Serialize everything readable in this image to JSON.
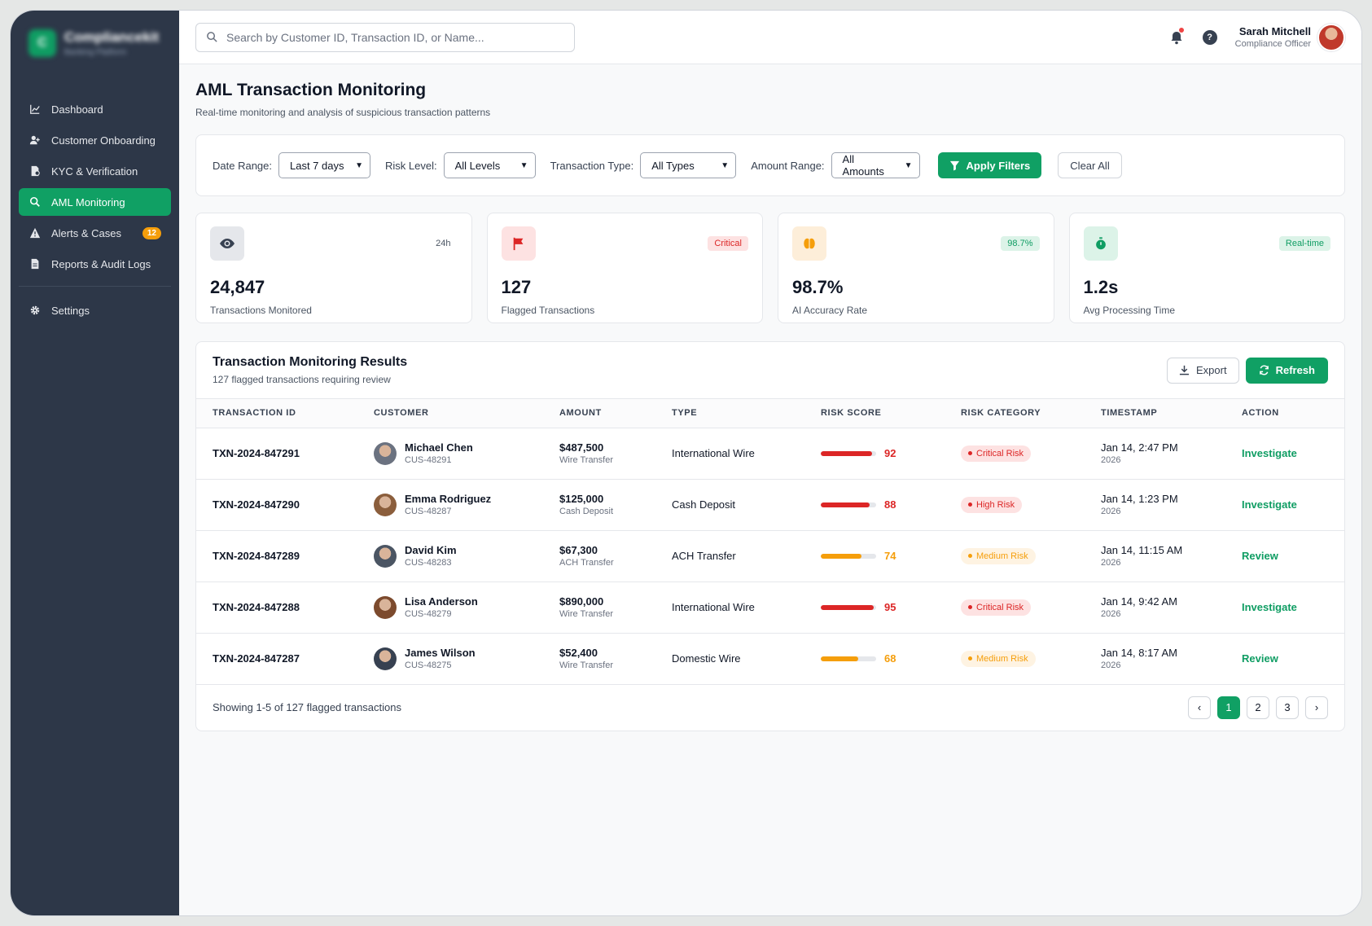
{
  "brand": {
    "name": "Compliancekit",
    "tagline": "Banking Platform",
    "mark": "C"
  },
  "sidebar": {
    "items": [
      {
        "label": "Dashboard",
        "icon": "chart-line-icon",
        "active": false
      },
      {
        "label": "Customer Onboarding",
        "icon": "user-plus-icon",
        "active": false
      },
      {
        "label": "KYC & Verification",
        "icon": "id-card-icon",
        "active": false
      },
      {
        "label": "AML Monitoring",
        "icon": "search-dollar-icon",
        "active": true
      },
      {
        "label": "Alerts & Cases",
        "icon": "warning-icon",
        "active": false,
        "badge": "12"
      },
      {
        "label": "Reports & Audit Logs",
        "icon": "file-icon",
        "active": false
      }
    ],
    "settings": {
      "label": "Settings",
      "icon": "gear-icon"
    }
  },
  "topbar": {
    "search_placeholder": "Search by Customer ID, Transaction ID, or Name...",
    "user": {
      "name": "Sarah Mitchell",
      "role": "Compliance Officer"
    },
    "help_glyph": "?"
  },
  "page": {
    "title": "AML Transaction Monitoring",
    "subtitle": "Real-time monitoring and analysis of suspicious transaction patterns"
  },
  "filters": {
    "date_range": {
      "label": "Date Range:",
      "value": "Last 7 days"
    },
    "risk_level": {
      "label": "Risk Level:",
      "value": "All Levels"
    },
    "transaction_type": {
      "label": "Transaction Type:",
      "value": "All Types"
    },
    "amount_range": {
      "label": "Amount Range:",
      "value": "All Amounts"
    },
    "apply_label": "Apply Filters",
    "clear_label": "Clear All"
  },
  "stats": [
    {
      "value": "24,847",
      "label": "Transactions Monitored",
      "tag": "24h",
      "icon": "eye-icon"
    },
    {
      "value": "127",
      "label": "Flagged Transactions",
      "tag": "Critical",
      "icon": "flag-icon"
    },
    {
      "value": "98.7%",
      "label": "AI Accuracy Rate",
      "tag": "98.7%",
      "icon": "brain-icon"
    },
    {
      "value": "1.2s",
      "label": "Avg Processing Time",
      "tag": "Real-time",
      "icon": "stopwatch-icon"
    }
  ],
  "results": {
    "title": "Transaction Monitoring Results",
    "subtitle": "127 flagged transactions requiring review",
    "export_label": "Export",
    "refresh_label": "Refresh",
    "columns": [
      "TRANSACTION ID",
      "CUSTOMER",
      "AMOUNT",
      "TYPE",
      "RISK SCORE",
      "RISK CATEGORY",
      "TIMESTAMP",
      "ACTION"
    ],
    "rows": [
      {
        "id": "TXN-2024-847291",
        "customer": "Michael Chen",
        "customer_id": "CUS-48291",
        "amount": "$487,500",
        "amount_type": "Wire Transfer",
        "type": "International Wire",
        "score": "92",
        "category": "Critical Risk",
        "time": "Jan 14, 2:47 PM",
        "year": "2026",
        "action": "Investigate"
      },
      {
        "id": "TXN-2024-847290",
        "customer": "Emma Rodriguez",
        "customer_id": "CUS-48287",
        "amount": "$125,000",
        "amount_type": "Cash Deposit",
        "type": "Cash Deposit",
        "score": "88",
        "category": "High Risk",
        "time": "Jan 14, 1:23 PM",
        "year": "2026",
        "action": "Investigate"
      },
      {
        "id": "TXN-2024-847289",
        "customer": "David Kim",
        "customer_id": "CUS-48283",
        "amount": "$67,300",
        "amount_type": "ACH Transfer",
        "type": "ACH Transfer",
        "score": "74",
        "category": "Medium Risk",
        "time": "Jan 14, 11:15 AM",
        "year": "2026",
        "action": "Review"
      },
      {
        "id": "TXN-2024-847288",
        "customer": "Lisa Anderson",
        "customer_id": "CUS-48279",
        "amount": "$890,000",
        "amount_type": "Wire Transfer",
        "type": "International Wire",
        "score": "95",
        "category": "Critical Risk",
        "time": "Jan 14, 9:42 AM",
        "year": "2026",
        "action": "Investigate"
      },
      {
        "id": "TXN-2024-847287",
        "customer": "James Wilson",
        "customer_id": "CUS-48275",
        "amount": "$52,400",
        "amount_type": "Wire Transfer",
        "type": "Domestic Wire",
        "score": "68",
        "category": "Medium Risk",
        "time": "Jan 14, 8:17 AM",
        "year": "2026",
        "action": "Review"
      }
    ],
    "footer": "Showing 1-5 of 127 flagged transactions",
    "pages": [
      "1",
      "2",
      "3"
    ],
    "current_page": "1"
  },
  "colors": {
    "accent": "#10a064",
    "critical": "#dc2626",
    "high": "#dc2626",
    "medium": "#f59e0b",
    "sidebar_bg": "#2d3748"
  }
}
